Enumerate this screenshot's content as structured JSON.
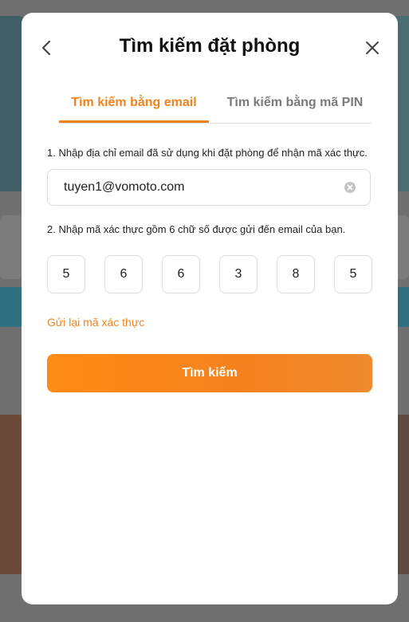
{
  "modal": {
    "title": "Tìm kiếm đặt phòng"
  },
  "tabs": [
    {
      "label": "Tìm kiếm bằng email",
      "active": true
    },
    {
      "label": "Tìm kiếm bằng mã PIN",
      "active": false
    }
  ],
  "step1": {
    "instruction": "1. Nhập địa chỉ email đã sử dụng khi đặt phòng để nhận mã xác thực.",
    "email_value": "tuyen1@vomoto.com"
  },
  "step2": {
    "instruction": "2. Nhập mã xác thực gồm 6 chữ số được gửi đến email của bạn.",
    "digits": [
      "5",
      "6",
      "6",
      "3",
      "8",
      "5"
    ]
  },
  "resend_label": "Gửi lại mã xác thực",
  "search_button_label": "Tìm kiếm",
  "icons": {
    "back": "chevron-left-icon",
    "close": "close-icon",
    "clear": "clear-circle-icon"
  },
  "colors": {
    "accent": "#f0821e",
    "overlay": "#6f6f6f"
  }
}
